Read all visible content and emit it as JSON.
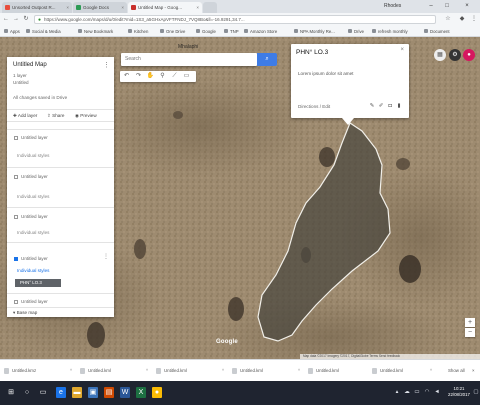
{
  "colors": {
    "map_land": "#9d8a6f",
    "polygon_fill": "#4a463e",
    "accent": "#3e7ce6",
    "profile": "#d5175f",
    "taskbar": "#1f2430"
  },
  "browser": {
    "tabs": [
      {
        "label": "Unsorted Outpost R...",
        "favicon": "#e84d3c"
      },
      {
        "label": "Google Docs",
        "favicon": "#2d9b55"
      },
      {
        "label": "Untitled Map - Goog...",
        "favicon": "#c9302c"
      },
      {
        "label": "",
        "favicon": ""
      }
    ],
    "user": "Rhodes",
    "minimize_icon": "minimize-icon",
    "maximize_icon": "maximize-icon",
    "close_icon": "close-icon",
    "url": "https://www.google.com/maps/d/u/0/edit?mid=1S3_a5GHxApVFTFNDJ_7VQ8Bo&ll=-16.9291,34.7...",
    "bookmarks": [
      "Apps",
      "Social & Media",
      "New Bookmark",
      "Kitchen",
      "One Drive",
      "Google",
      "TNP",
      "Amazon Store",
      "NPA Monthly Re...",
      "Drive",
      "refresh monthly",
      "Document"
    ]
  },
  "map": {
    "search_placeholder": "Search",
    "top_label": "Mhalaphi",
    "tools": [
      "undo-icon",
      "redo-icon",
      "hand-icon",
      "marker-icon",
      "line-icon",
      "ruler-icon"
    ],
    "panel": {
      "title": "Untitled Map",
      "subtitle_1": "1 layer",
      "subtitle_2": "Untitled",
      "subtitle_3": "All changes saved in Drive",
      "actions": [
        "Add layer",
        "Share",
        "Preview"
      ],
      "layers": [
        {
          "name": "Untitled layer",
          "sub": "Individual styles",
          "checked": false
        },
        {
          "name": "Untitled layer",
          "sub": "Individual styles",
          "checked": false
        },
        {
          "name": "Untitled layer",
          "sub": "Individual styles",
          "checked": false
        },
        {
          "name": "Untitled layer",
          "sub": "",
          "checked": true
        }
      ],
      "import_link": "Individual styles",
      "feature_label": "PHN° LO.3",
      "base_map": "Base map"
    },
    "popup": {
      "title": "PHN° LO.3",
      "description": "Lorem ipsum dolor sit amet",
      "link": "Directions / Edit",
      "tools": [
        "paint-icon",
        "edit-icon",
        "camera-icon",
        "delete-icon"
      ]
    },
    "google_logo": "Google",
    "attribution": "Map data ©2017 Imagery ©2017, DigitalGlobe  Terms  Send feedback"
  },
  "downloads": {
    "items": [
      "Untitled.kmz",
      "Untitled.kml",
      "Untitled.kml",
      "Untitled.kml",
      "Untitled.kml",
      "Untitled.kml"
    ],
    "show_all": "Show all"
  },
  "taskbar": {
    "time": "10:21",
    "date": "22/08/2017"
  }
}
